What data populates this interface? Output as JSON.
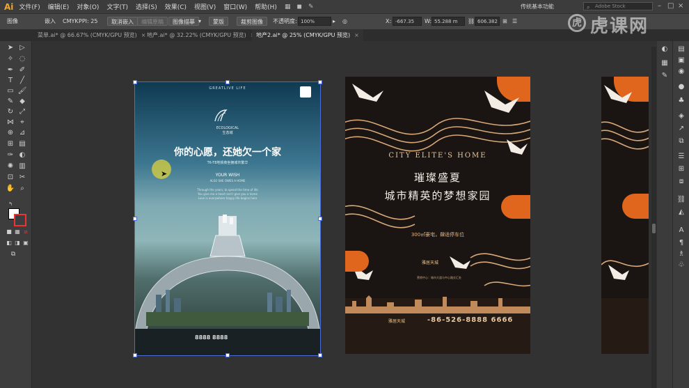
{
  "menubar": {
    "app_logo": "Ai",
    "items": [
      "文件(F)",
      "编辑(E)",
      "对象(O)",
      "文字(T)",
      "选择(S)",
      "效果(C)",
      "视图(V)",
      "窗口(W)",
      "帮助(H)"
    ],
    "workspace": "传统基本功能",
    "search_placeholder": "Adobe Stock"
  },
  "control_bar": {
    "object_label": "图像",
    "embed_button": "嵌入",
    "color_mode": "CMYK",
    "ppi": "PPI: 25",
    "crop_button": "取消嵌入",
    "mask_button": "编辑原稿",
    "trace_button": "图像描摹",
    "mask2_button": "蒙版",
    "crop2_button": "裁剪图像",
    "opacity_label": "不透明度:",
    "opacity_value": "100%",
    "x_label": "X:",
    "x_value": "-667.35",
    "w_label": "W:",
    "w_value": "55.288 m",
    "y_value": "606.382"
  },
  "tabs": [
    {
      "label": "菜单.ai* @ 66.67% (CMYK/GPU 预览)",
      "close": "×"
    },
    {
      "label": "地产.ai* @ 32.22% (CMYK/GPU 预览)",
      "close": "×"
    },
    {
      "label": "地产2.ai* @ 25% (CMYK/GPU 预览)",
      "close": "×"
    }
  ],
  "watermark": {
    "text": "虎课网",
    "icon": "虎"
  },
  "poster1": {
    "top_text": "GREATLIVE LIFE",
    "brand": "ECOLOGICAL",
    "brand_sub": "生态城",
    "headline": "你的心愿，还她欠一个家",
    "sub": "T6-T8地铁旁坐拥城市繁华",
    "wish": "YOUR WISH",
    "wish_sub": "ALSO SHE OWES A HOME",
    "body_line1": "Through the years, to spend the time of life",
    "body_line2": "You give me a heart and I give you a home",
    "body_line3": "Love is everywhere happy life begins here",
    "phone": "8888 8888",
    "badge_icon": "qr-icon"
  },
  "poster2": {
    "title_en": "CITY ELITE'S HOME",
    "title_cn1": "璀璨盛夏",
    "title_cn2": "城市精英的梦想家园",
    "sub": "300㎡豪宅，肆适停车位",
    "brand_mid": "雅居天城",
    "address": "营销中心：城市大道与中心路交汇处",
    "phone": "-86-526-8888 6666",
    "brand_bottom": "雅居天城"
  },
  "colors": {
    "accent_orange": "#e1661d",
    "gold": "#e6c8a2",
    "selection_blue": "#4a6cd4"
  }
}
